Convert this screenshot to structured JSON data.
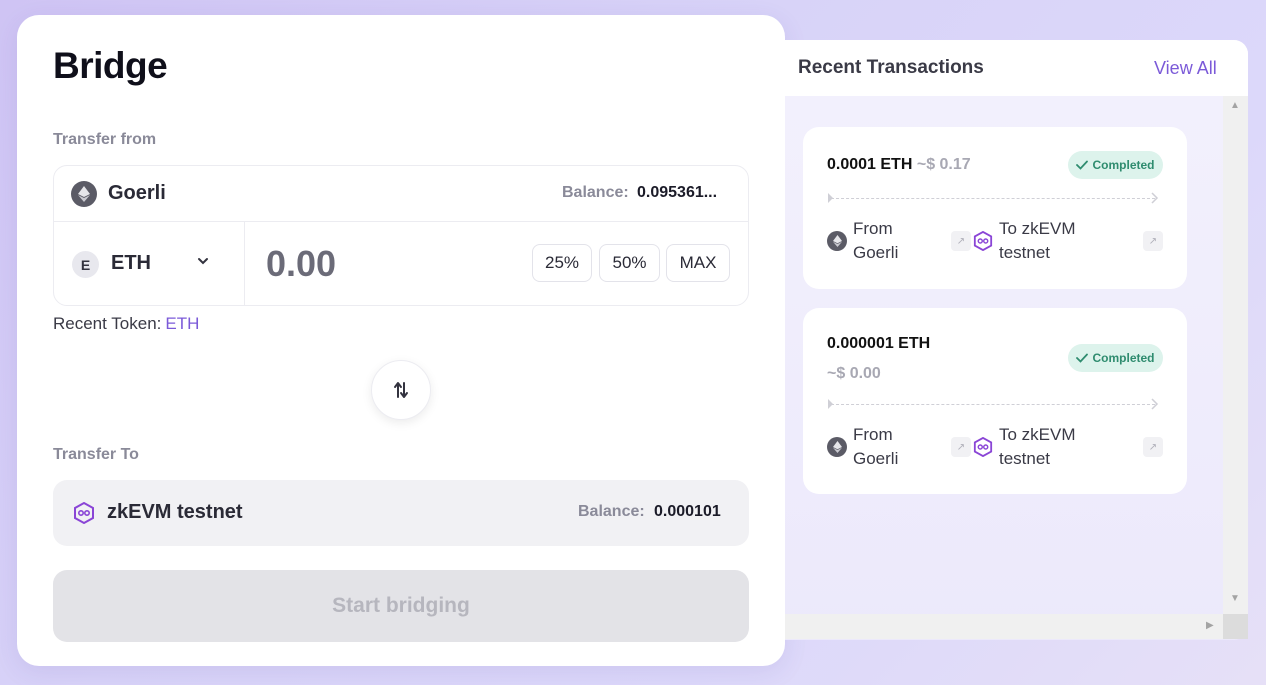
{
  "bridge": {
    "title": "Bridge",
    "transfer_from_label": "Transfer from",
    "from_network": "Goerli",
    "from_balance_label": "Balance:",
    "from_balance_value": "0.095361...",
    "token": {
      "badge": "E",
      "name": "ETH"
    },
    "amount_placeholder": "0.00",
    "pct_buttons": [
      "25%",
      "50%",
      "MAX"
    ],
    "recent_token_label": "Recent Token:",
    "recent_token_value": "ETH",
    "transfer_to_label": "Transfer To",
    "to_network": "zkEVM testnet",
    "to_balance_label": "Balance:",
    "to_balance_value": "0.000101",
    "start_button": "Start bridging"
  },
  "recent": {
    "title": "Recent Transactions",
    "view_all": "View All",
    "transactions": [
      {
        "amount": "0.0001 ETH",
        "usd": "~$ 0.17",
        "status": "Completed",
        "from_line1": "From",
        "from_line2": "Goerli",
        "to_line1": "To zkEVM",
        "to_line2": "testnet"
      },
      {
        "amount": "0.000001 ETH",
        "usd": "~$ 0.00",
        "status": "Completed",
        "from_line1": "From",
        "from_line2": "Goerli",
        "to_line1": "To zkEVM",
        "to_line2": "testnet"
      }
    ]
  },
  "icons": {
    "from_network": "ethereum-icon",
    "to_network": "polygon-zkevm-icon",
    "token": "token-badge",
    "dropdown": "chevron-down-icon",
    "swap": "swap-arrows-icon",
    "status": "check-icon",
    "external": "external-link-icon"
  },
  "colors": {
    "accent": "#7b5ad8",
    "success_bg": "#ddf3ec",
    "success_text": "#2f8c6f"
  }
}
